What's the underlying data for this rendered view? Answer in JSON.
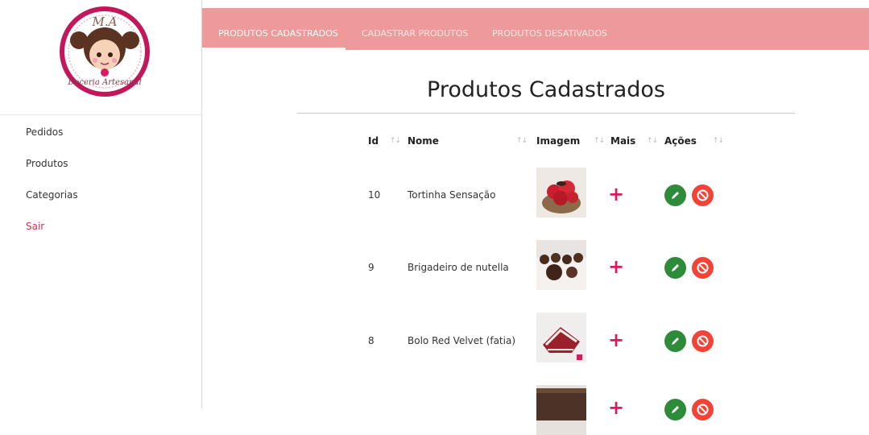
{
  "sidebar": {
    "logo_text": "Doceria Artesanal",
    "logo_initials": "M.A",
    "items": [
      {
        "label": "Pedidos"
      },
      {
        "label": "Produtos"
      },
      {
        "label": "Categorias"
      },
      {
        "label": "Sair"
      }
    ]
  },
  "tabs": [
    {
      "label": "PRODUTOS CADASTRADOS",
      "active": true
    },
    {
      "label": "CADASTRAR PRODUTOS",
      "active": false
    },
    {
      "label": "PRODUTOS DESATIVADOS",
      "active": false
    }
  ],
  "page_title": "Produtos Cadastrados",
  "table": {
    "headers": [
      "Id",
      "Nome",
      "Imagem",
      "Mais",
      "Ações"
    ],
    "rows": [
      {
        "id": "10",
        "name": "Tortinha Sensação",
        "image": "strawberry-tart"
      },
      {
        "id": "9",
        "name": "Brigadeiro de nutella",
        "image": "chocolate-truffles"
      },
      {
        "id": "8",
        "name": "Bolo Red Velvet (fatia)",
        "image": "red-velvet-slice"
      },
      {
        "id": "",
        "name": "",
        "image": "chocolate-cake"
      }
    ]
  },
  "colors": {
    "topbar": "#ef9a9a",
    "plus": "#d81b60",
    "edit": "#2e8b3a",
    "disable": "#f44336",
    "logout": "#d2344a"
  }
}
